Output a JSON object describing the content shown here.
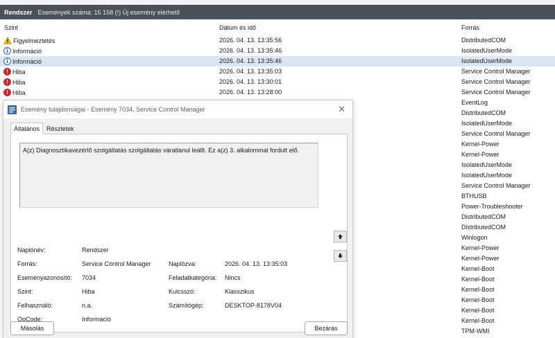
{
  "header": {
    "title": "Rendszer",
    "info": "Események száma: 15 158 (!) Új esemény elérhető"
  },
  "columns": {
    "level": "Szint",
    "date": "Dátum és idő",
    "source": "Forrás"
  },
  "events": [
    {
      "level": "Figyelmeztetés",
      "icon": "warning-icon",
      "date": "2026. 04. 13. 13:35:56",
      "source": "DistributedCOM"
    },
    {
      "level": "Információ",
      "icon": "info-icon",
      "date": "2026. 04. 13. 13:35:46",
      "source": "IsolatedUserMode"
    },
    {
      "level": "Információ",
      "icon": "info-icon",
      "date": "2026. 04. 13. 13:35:46",
      "source": "IsolatedUserMode"
    },
    {
      "level": "Hiba",
      "icon": "error-icon",
      "date": "2026. 04. 13. 13:35:03",
      "source": "Service Control Manager"
    },
    {
      "level": "Hiba",
      "icon": "error-icon",
      "date": "2026. 04. 13. 13:30:01",
      "source": "Service Control Manager"
    },
    {
      "level": "Hiba",
      "icon": "error-icon",
      "date": "2026. 04. 13. 13:28:00",
      "source": "Service Control Manager"
    }
  ],
  "more_sources": [
    "EventLog",
    "DistributedCOM",
    "IsolatedUserMode",
    "Service Control Manager",
    "Kernel-Power",
    "Kernel-Power",
    "IsolatedUserMode",
    "IsolatedUserMode",
    "Service Control Manager",
    "BTHUSB",
    "Power-Troubleshooter",
    "DistributedCOM",
    "DistributedCOM",
    "Winlogon",
    "Kernel-Power",
    "Kernel-Power",
    "Kernel-Boot",
    "Kernel-Boot",
    "Kernel-Boot",
    "Kernel-Boot",
    "Kernel-Boot",
    "Kernel-Boot",
    "TPM-WMI"
  ],
  "dialog": {
    "title": "Esemény tulajdonságai - Esemény 7034, Service Control Manager",
    "tabs": [
      "Általános",
      "Részletek"
    ],
    "description": "A(z) Diagnosztikavezérlő szolgáltatás szolgáltatás váratlanul leállt. Ez a(z) 3. alkalommal fordult elő.",
    "fields": {
      "log_name_label": "Naplónév:",
      "log_name": "Rendszer",
      "source_label": "Forrás:",
      "source": "Service Control Manager",
      "logged_label": "Naplózva:",
      "logged": "2026. 04. 13. 13:35:03",
      "event_id_label": "Eseményazonosító:",
      "event_id": "7034",
      "task_label": "Feladatkategória:",
      "task": "Nincs",
      "level_label": "Szint:",
      "level": "Hiba",
      "keyword_label": "Kulcsszó:",
      "keyword": "Klasszikus",
      "user_label": "Felhasználó:",
      "user": "n.a.",
      "computer_label": "Számítógép:",
      "computer": "DESKTOP-8178V04",
      "opcode_label": "OpCode:",
      "opcode": "Információ"
    },
    "copy_button": "Másolás",
    "close_button": "Bezárás"
  },
  "colors": {
    "header_bg": "#4a4f58",
    "selected_row": "#dce6f2",
    "error": "#c82a2a",
    "info": "#2a63b8",
    "warning": "#f2c200"
  }
}
